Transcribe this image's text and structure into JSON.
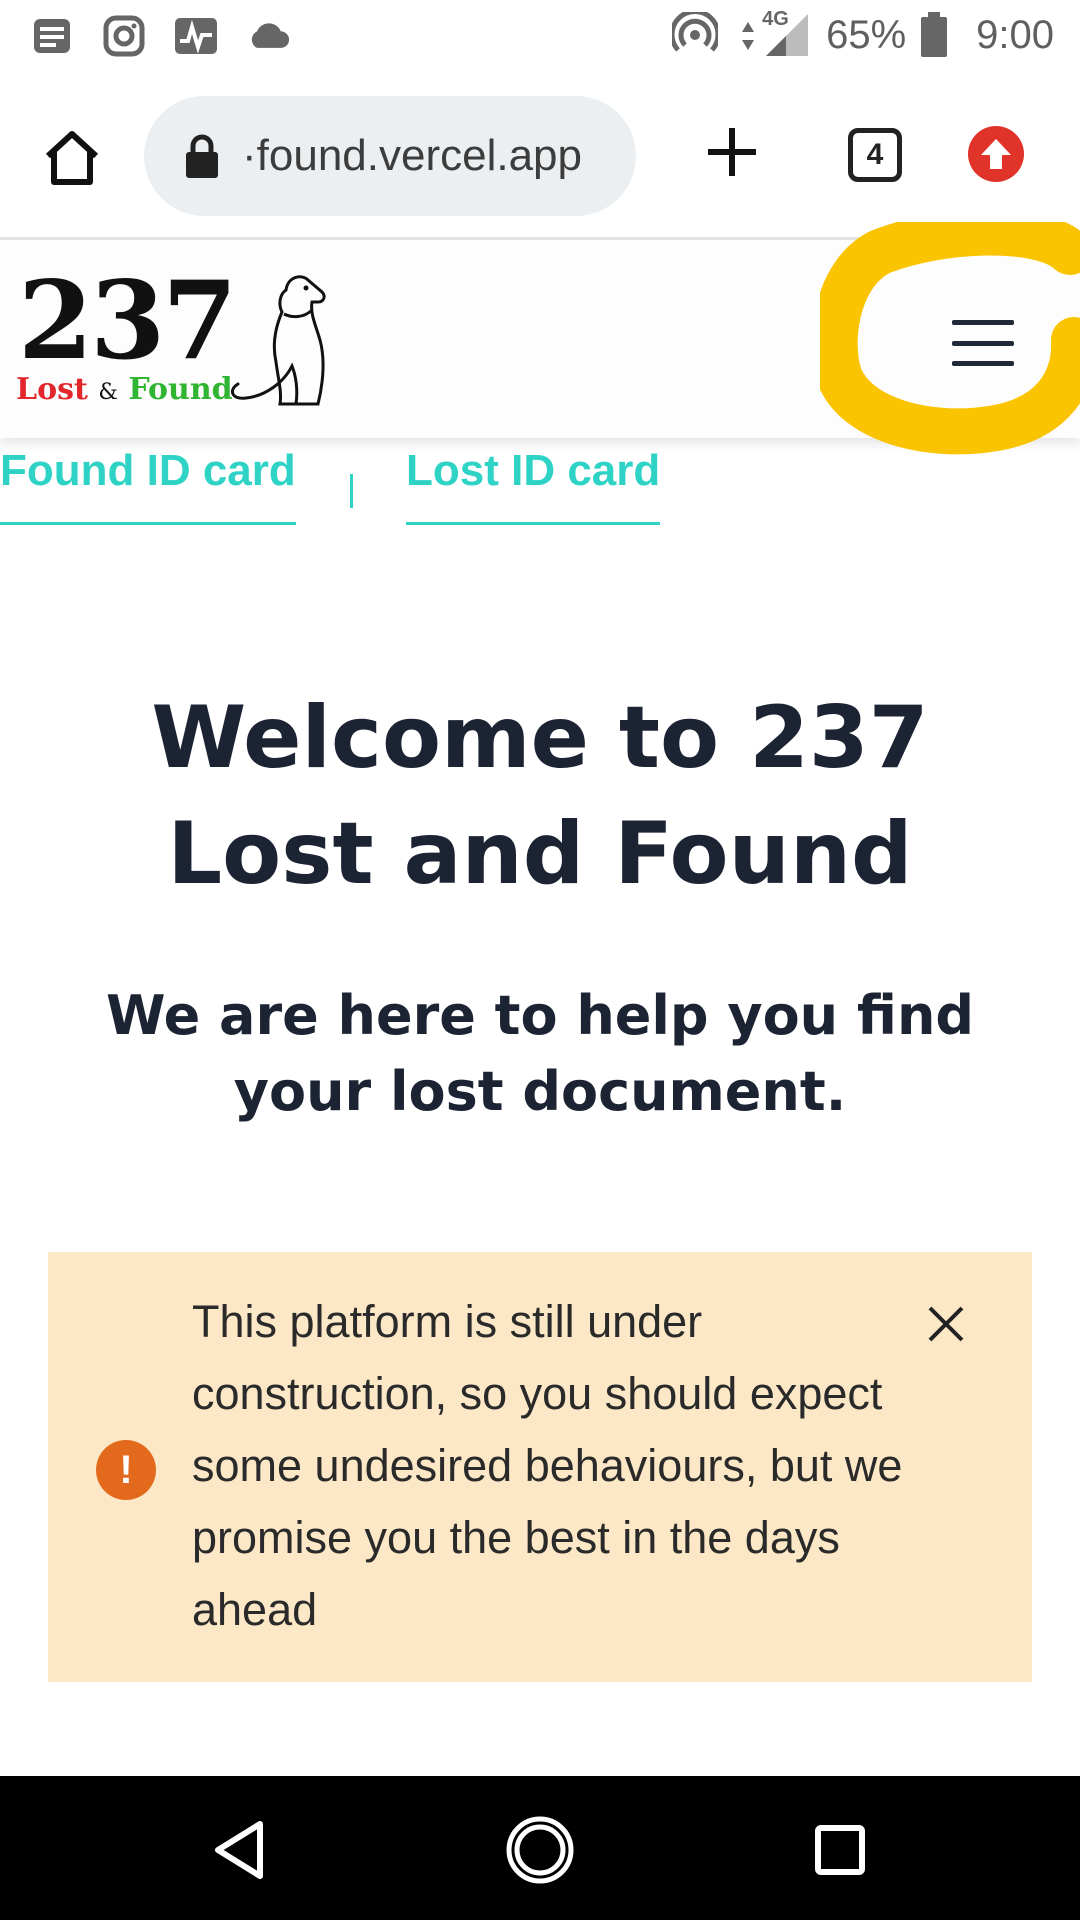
{
  "status_bar": {
    "battery": "65%",
    "network": "4G",
    "time": "9:00"
  },
  "browser": {
    "url": "found.vercel.app",
    "tab_count": "4"
  },
  "header": {
    "logo_number": "237",
    "logo_lost": "Lost",
    "logo_amp": "&",
    "logo_found": "Found"
  },
  "tabs": {
    "found": "Found ID card",
    "lost": "Lost ID card"
  },
  "hero": {
    "title": "Welcome to 237 Lost and Found",
    "subtitle": "We are here to help you find your lost document."
  },
  "alert": {
    "icon": "!",
    "message": "This platform is still under construction, so you should expect some undesired behaviours, but we promise you the best in the days ahead"
  },
  "colors": {
    "accent_teal": "#2ed3c6",
    "highlight_yellow": "#fbc400",
    "alert_bg": "#fce8c6",
    "alert_icon": "#e36a1c"
  }
}
